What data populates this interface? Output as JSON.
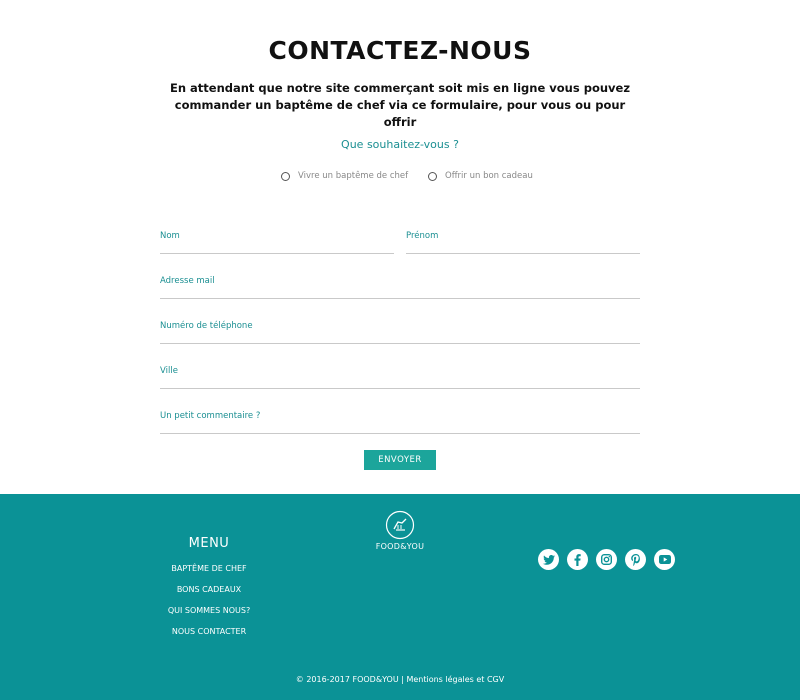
{
  "header": {
    "title": "CONTACTEZ-NOUS",
    "intro": "En attendant que notre site commerçant soit mis en ligne vous pouvez commander un baptême de chef via ce formulaire, pour vous ou pour offrir"
  },
  "form": {
    "question": "Que souhaitez-vous ?",
    "options": [
      {
        "label": "Vivre un baptême de chef"
      },
      {
        "label": "Offrir un bon cadeau"
      }
    ],
    "fields": {
      "nom": "Nom",
      "prenom": "Prénom",
      "mail": "Adresse mail",
      "telephone": "Numéro de téléphone",
      "ville": "Ville",
      "commentaire": "Un petit commentaire ?"
    },
    "submit_label": "ENVOYER"
  },
  "footer": {
    "menu_title": "MENU",
    "menu_items": [
      {
        "label": "BAPTÊME DE CHEF"
      },
      {
        "label": "BONS CADEAUX"
      },
      {
        "label": "QUI SOMMES NOUS?"
      },
      {
        "label": "NOUS CONTACTER"
      }
    ],
    "brand": "FOOD&YOU",
    "socials": [
      {
        "icon": "twitter-icon"
      },
      {
        "icon": "facebook-icon"
      },
      {
        "icon": "instagram-icon"
      },
      {
        "icon": "pinterest-icon"
      },
      {
        "icon": "youtube-icon"
      }
    ],
    "copyright": "© 2016-2017 FOOD&YOU | Mentions légales et CGV"
  },
  "colors": {
    "accent": "#1b8f92",
    "footer_bg": "#0b9296",
    "button_bg": "#1ca59b"
  }
}
